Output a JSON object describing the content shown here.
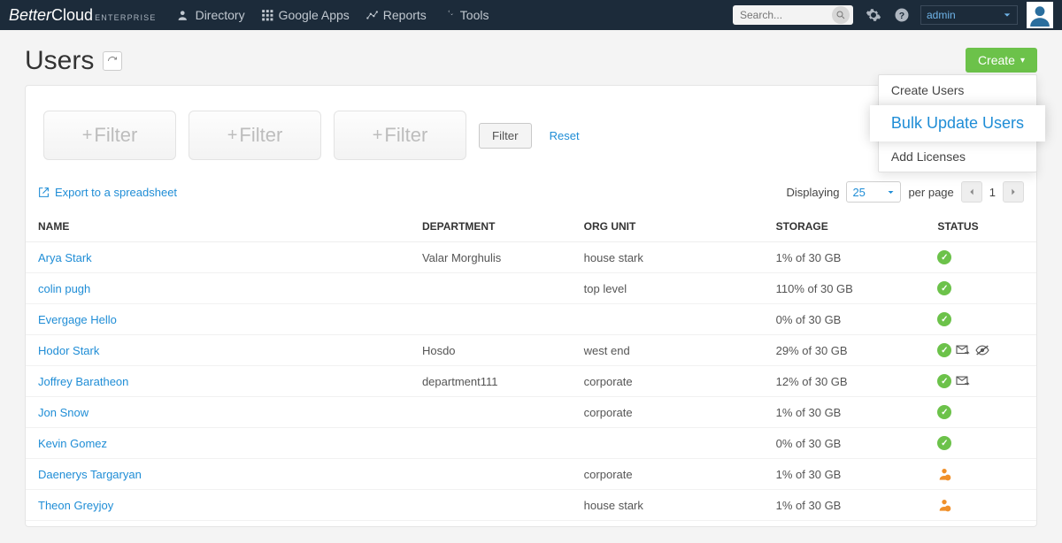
{
  "brand": {
    "name1": "Better",
    "name2": "Cloud",
    "sub": "ENTERPRISE"
  },
  "nav": {
    "directory": "Directory",
    "googleapps": "Google Apps",
    "reports": "Reports",
    "tools": "Tools"
  },
  "search": {
    "placeholder": "Search..."
  },
  "adminbox": {
    "label": "admin"
  },
  "page": {
    "title": "Users",
    "filter_label": "Filter",
    "filter_button": "Filter",
    "reset": "Reset",
    "export": "Export to a spreadsheet",
    "displaying": "Displaying",
    "perpage_value": "25",
    "perpage_label": "per page",
    "pagenum": "1"
  },
  "create": {
    "button": "Create",
    "items": [
      "Create Users",
      "Bulk Update Users",
      "Add Licenses"
    ],
    "highlight_index": 1
  },
  "columns": {
    "name": "NAME",
    "department": "DEPARTMENT",
    "orgunit": "ORG UNIT",
    "storage": "STORAGE",
    "status": "STATUS"
  },
  "rows": [
    {
      "name": "Arya Stark",
      "department": "Valar Morghulis",
      "orgunit": "house stark",
      "storage": "1% of 30 GB",
      "status": "ok",
      "extras": []
    },
    {
      "name": "colin pugh",
      "department": "",
      "orgunit": "top level",
      "storage": "110% of 30 GB",
      "status": "ok",
      "extras": []
    },
    {
      "name": "Evergage Hello",
      "department": "",
      "orgunit": "",
      "storage": "0% of 30 GB",
      "status": "ok",
      "extras": []
    },
    {
      "name": "Hodor Stark",
      "department": "Hosdo",
      "orgunit": "west end",
      "storage": "29% of 30 GB",
      "status": "ok",
      "extras": [
        "mail",
        "hidden"
      ]
    },
    {
      "name": "Joffrey Baratheon",
      "department": "department111",
      "orgunit": "corporate",
      "storage": "12% of 30 GB",
      "status": "ok",
      "extras": [
        "mail"
      ]
    },
    {
      "name": "Jon Snow",
      "department": "",
      "orgunit": "corporate",
      "storage": "1% of 30 GB",
      "status": "ok",
      "extras": []
    },
    {
      "name": "Kevin Gomez",
      "department": "",
      "orgunit": "",
      "storage": "0% of 30 GB",
      "status": "ok",
      "extras": []
    },
    {
      "name": "Daenerys Targaryan",
      "department": "",
      "orgunit": "corporate",
      "storage": "1% of 30 GB",
      "status": "user",
      "extras": []
    },
    {
      "name": "Theon Greyjoy",
      "department": "",
      "orgunit": "house stark",
      "storage": "1% of 30 GB",
      "status": "user",
      "extras": []
    }
  ]
}
